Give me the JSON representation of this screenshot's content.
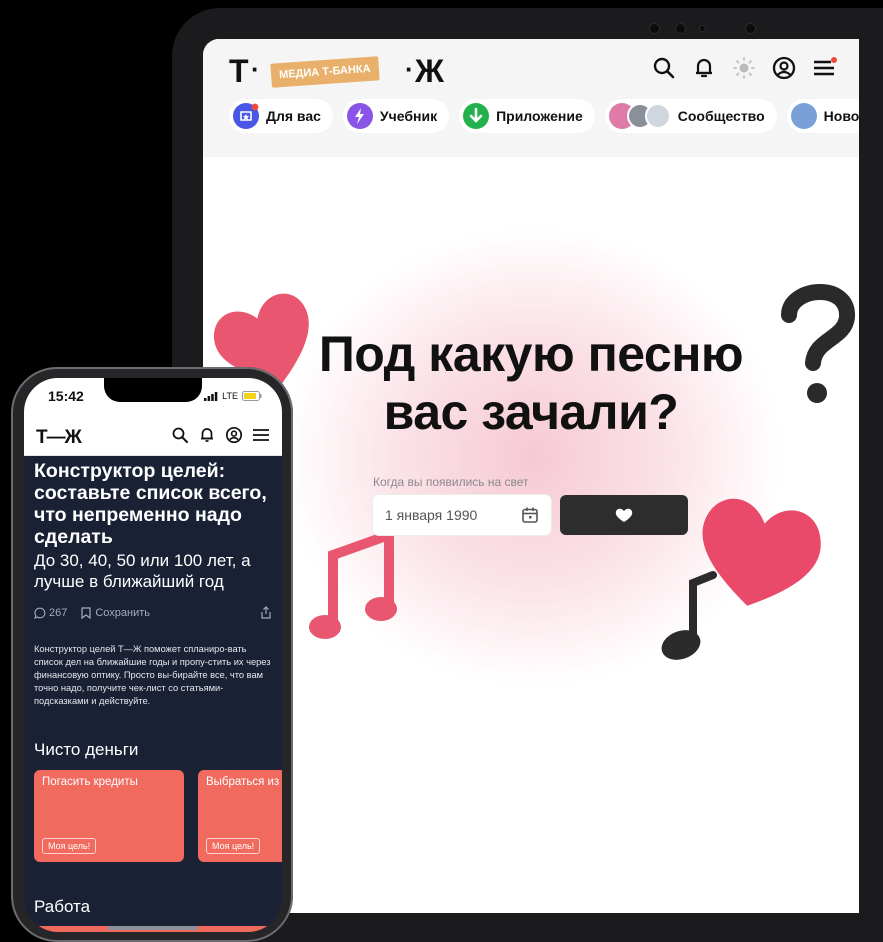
{
  "tablet": {
    "logo": {
      "left": "Т",
      "badge": "МЕДИА Т-БАНКА",
      "right": "Ж"
    },
    "header_icons": [
      "search-icon",
      "bell-icon",
      "theme-sun-icon",
      "profile-icon",
      "menu-icon"
    ],
    "chips": [
      {
        "label": "Для вас",
        "icon": "for-you-icon",
        "color": "#4a56e6"
      },
      {
        "label": "Учебник",
        "icon": "textbook-icon",
        "color": "#8a54e8"
      },
      {
        "label": "Приложение",
        "icon": "download-app-icon",
        "color": "#22b14c"
      },
      {
        "label": "Сообщество",
        "icon": "community-avatars-icon",
        "color": "#e07aa8"
      },
      {
        "label": "Ново",
        "icon": "news-icon",
        "color": "#7aa0d8"
      }
    ],
    "hero": {
      "title_line1": "Под какую песню",
      "title_line2": "вас зачали?",
      "date_label": "Когда вы появились на свет",
      "date_value": "1 января 1990",
      "submit_icon": "heart-icon"
    }
  },
  "phone": {
    "status": {
      "time": "15:42",
      "network": "LTE"
    },
    "logo": "Т—Ж",
    "header_icons": [
      "search-icon",
      "bell-icon",
      "profile-icon",
      "menu-icon"
    ],
    "article": {
      "title": "Конструктор целей: составьте список всего, что непременно надо сделать",
      "subtitle": "До 30, 40, 50 или 100 лет, а лучше в ближайший год",
      "comments": "267",
      "save_label": "Сохранить",
      "description": "Конструктор целей Т—Ж поможет спланиро-вать список дел на ближайшие годы и пропу-стить их через финансовую оптику. Просто вы-бирайте все, что вам точно надо, получите чек-лист со статьями-подсказками и действуйте."
    },
    "section1": {
      "title": "Чисто деньги",
      "cards": [
        {
          "title": "Погасить кредиты",
          "button": "Моя цель!"
        },
        {
          "title": "Выбраться из долговой",
          "button": "Моя цель!"
        }
      ]
    },
    "section2": {
      "title": "Работа"
    }
  }
}
